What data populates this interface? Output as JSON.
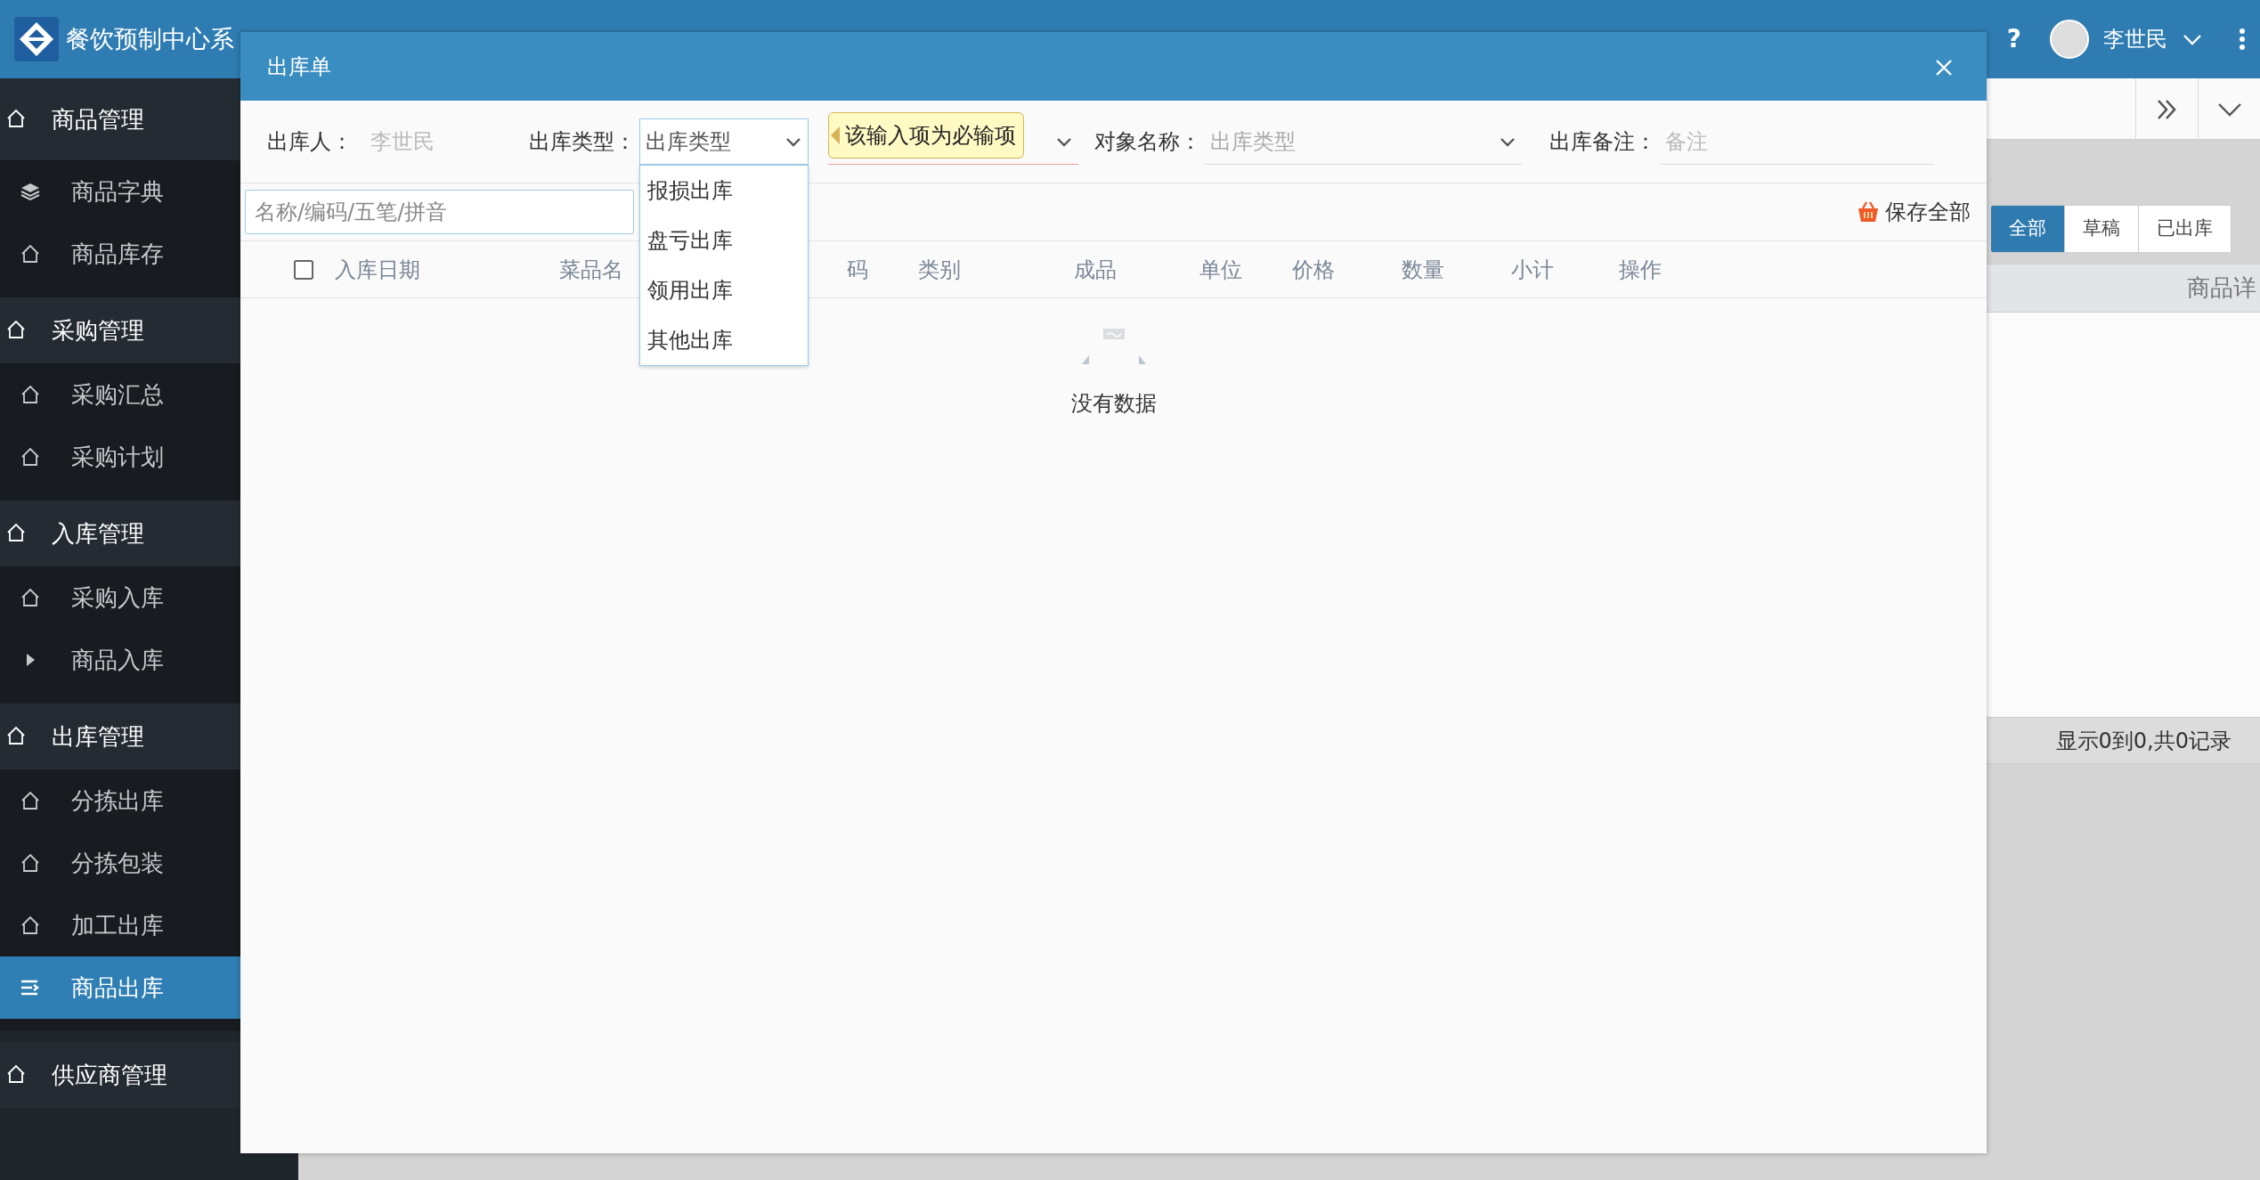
{
  "app": {
    "title": "餐饮预制中心系",
    "help": "?",
    "user": "李世民"
  },
  "sidebar": {
    "groups": [
      {
        "label": "商品管理",
        "items": [
          {
            "label": "商品字典",
            "kind": "layers",
            "selected": false
          },
          {
            "label": "商品库存",
            "kind": "home",
            "selected": false
          }
        ]
      },
      {
        "label": "采购管理",
        "items": [
          {
            "label": "采购汇总",
            "kind": "home",
            "selected": false
          },
          {
            "label": "采购计划",
            "kind": "home",
            "selected": false
          }
        ]
      },
      {
        "label": "入库管理",
        "items": [
          {
            "label": "采购入库",
            "kind": "home",
            "selected": false
          },
          {
            "label": "商品入库",
            "kind": "arrow",
            "selected": false
          }
        ]
      },
      {
        "label": "出库管理",
        "items": [
          {
            "label": "分拣出库",
            "kind": "home",
            "selected": false
          },
          {
            "label": "分拣包装",
            "kind": "home",
            "selected": false
          },
          {
            "label": "加工出库",
            "kind": "home",
            "selected": false
          },
          {
            "label": "商品出库",
            "kind": "menu",
            "selected": true
          }
        ]
      },
      {
        "label": "供应商管理"
      }
    ]
  },
  "page": {
    "filter_tabs": [
      {
        "label": "全部",
        "selected": true
      },
      {
        "label": "草稿",
        "selected": false
      },
      {
        "label": "已出库",
        "selected": false
      }
    ],
    "table": {
      "columns": [
        "商品详"
      ]
    },
    "footer": "显示0到0,共0记录"
  },
  "dialog": {
    "title": "出库单",
    "fields": [
      {
        "kind": "text",
        "label": "出库人：",
        "value": "李世民"
      },
      {
        "kind": "select",
        "label": "出库类型：",
        "placeholder": "出库类型",
        "expanded": true,
        "options": [
          "报损出库",
          "盘亏出库",
          "领用出库",
          "其他出库"
        ]
      },
      {
        "kind": "select",
        "invalid": true,
        "error": "该输入项为必输项"
      },
      {
        "kind": "select",
        "label": "对象名称：",
        "placeholder": "出库类型"
      },
      {
        "kind": "input",
        "label": "出库备注：",
        "placeholder": "备注"
      }
    ],
    "search": {
      "placeholder": "名称/编码/五笔/拼音"
    },
    "save_button": "保存全部",
    "table": {
      "select_all_checked": false,
      "columns": [
        "入库日期",
        "菜品名",
        "码",
        "类别",
        "成品",
        "单位",
        "价格",
        "数量",
        "小计",
        "操作"
      ],
      "empty_text": "没有数据"
    }
  }
}
